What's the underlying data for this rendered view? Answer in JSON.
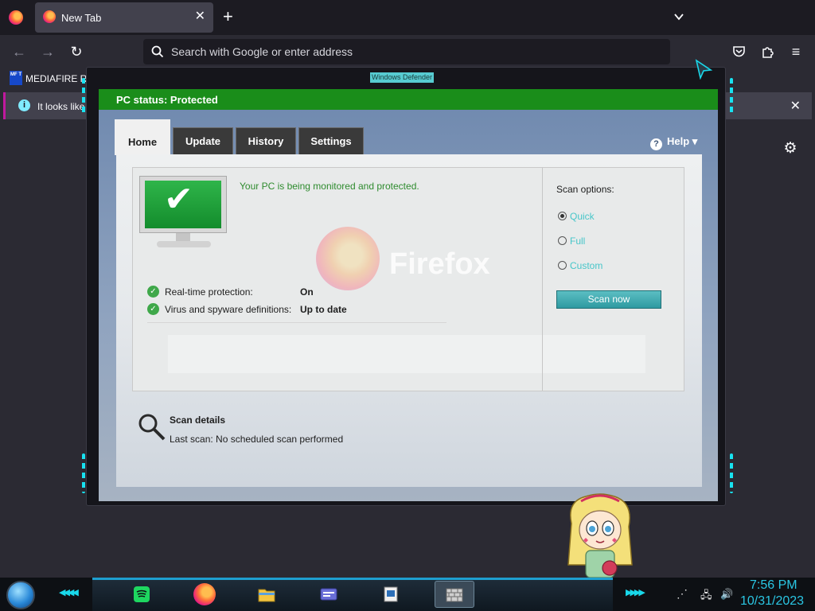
{
  "browser": {
    "tab_title": "New Tab",
    "url_placeholder": "Search with Google or enter address",
    "bookmark_label": "MEDIAFIRE R",
    "bookmark_icon_text": "MF T",
    "infobar_text": "It looks like"
  },
  "defender": {
    "window_title": "Windows Defender",
    "status": "PC status: Protected",
    "tabs": [
      {
        "label": "Home",
        "active": true
      },
      {
        "label": "Update",
        "active": false
      },
      {
        "label": "History",
        "active": false
      },
      {
        "label": "Settings",
        "active": false
      }
    ],
    "help_label": "Help",
    "protected_message": "Your PC is being monitored and protected.",
    "watermark_text": "Firefox",
    "protection_rows": [
      {
        "label": "Real-time protection:",
        "value": "On"
      },
      {
        "label": "Virus and spyware definitions:",
        "value": "Up to date"
      }
    ],
    "scan_options_title": "Scan options:",
    "scan_options": [
      {
        "label": "Quick",
        "selected": true
      },
      {
        "label": "Full",
        "selected": false
      },
      {
        "label": "Custom",
        "selected": false
      }
    ],
    "scan_button": "Scan now",
    "scan_details_title": "Scan details",
    "last_scan": "Last scan:  No scheduled scan performed"
  },
  "taskbar": {
    "time": "7:56 PM",
    "date": "10/31/2023",
    "apps": [
      "spotify",
      "firefox",
      "file-explorer",
      "id-card-app",
      "notepad-app",
      "firewall-app"
    ]
  },
  "colors": {
    "status_green": "#1a8d1a",
    "accent_cyan": "#2ac6e3",
    "scan_button": "#2f9aa1"
  }
}
